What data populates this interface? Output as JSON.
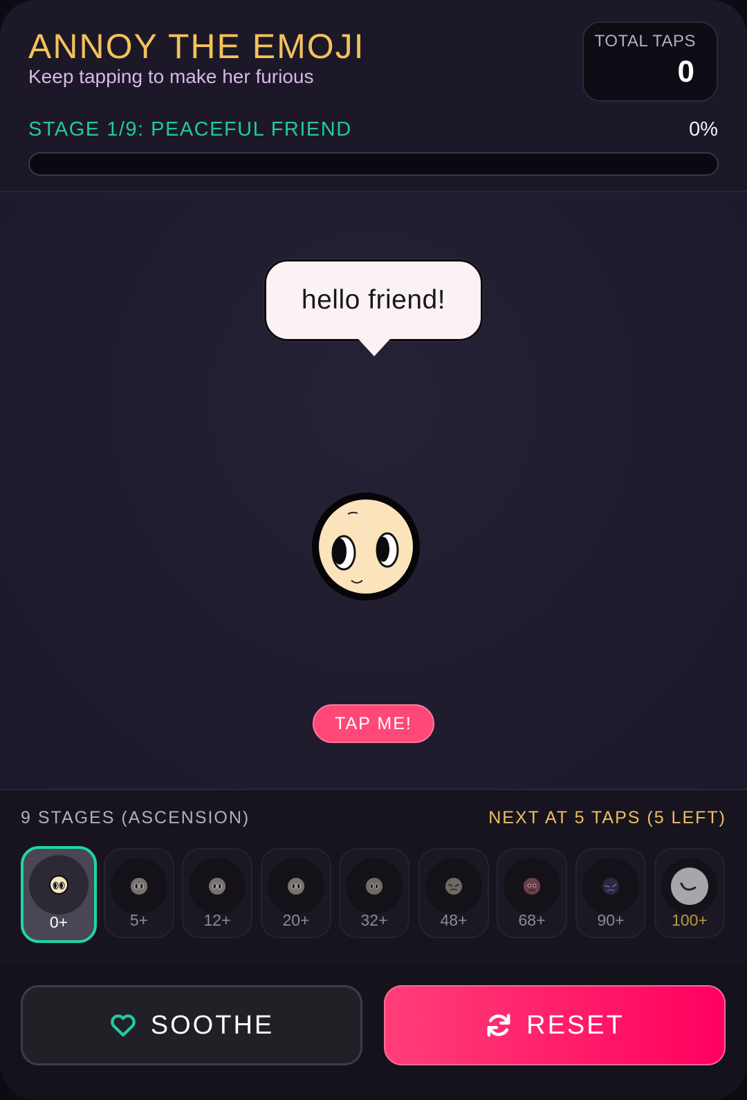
{
  "header": {
    "title": "ANNOY THE EMOJI",
    "subtitle": "Keep tapping to make her furious",
    "total_taps_label": "TOTAL TAPS",
    "total_taps_value": "0"
  },
  "progress": {
    "stage_label": "STAGE 1/9: PEACEFUL FRIEND",
    "percent_label": "0%",
    "percent": 0
  },
  "play": {
    "speech": "hello friend!",
    "tap_label": "TAP ME!"
  },
  "stages": {
    "title": "9 STAGES (ASCENSION)",
    "next_label": "NEXT AT 5 TAPS (5 LEFT)",
    "items": [
      {
        "label": "0+",
        "active": true
      },
      {
        "label": "5+"
      },
      {
        "label": "12+"
      },
      {
        "label": "20+"
      },
      {
        "label": "32+"
      },
      {
        "label": "48+"
      },
      {
        "label": "68+"
      },
      {
        "label": "90+"
      },
      {
        "label": "100+"
      }
    ]
  },
  "buttons": {
    "soothe": "SOOTHE",
    "reset": "RESET"
  },
  "colors": {
    "title": "#f3c25a",
    "accent_green": "#23c99e",
    "accent_pink": "#ff4778",
    "next_gold": "#f1be5f"
  },
  "icons": {
    "soothe": "heart-icon",
    "reset": "refresh-icon"
  }
}
